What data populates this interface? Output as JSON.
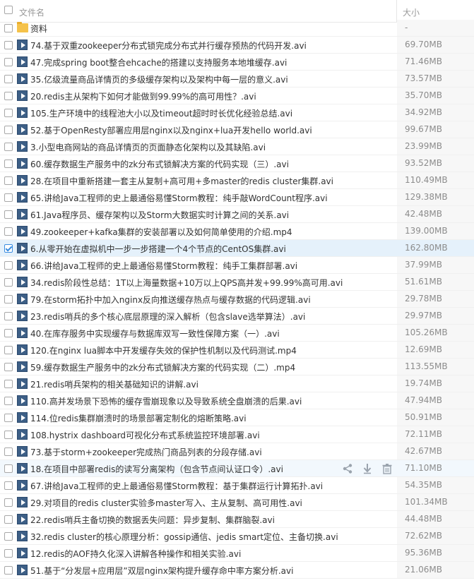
{
  "header": {
    "name_label": "文件名",
    "size_label": "大小"
  },
  "files": [
    {
      "name": "资料",
      "size": "-",
      "type": "folder",
      "checked": false
    },
    {
      "name": "74.基于双重zookeeper分布式锁完成分布式并行缓存预热的代码开发.avi",
      "size": "69.70MB",
      "type": "video",
      "checked": false
    },
    {
      "name": "47.完成spring boot整合ehcache的搭建以支持服务本地堆缓存.avi",
      "size": "71.46MB",
      "type": "video",
      "checked": false
    },
    {
      "name": "35.亿级流量商品详情页的多级缓存架构以及架构中每一层的意义.avi",
      "size": "73.57MB",
      "type": "video",
      "checked": false
    },
    {
      "name": "20.redis主从架构下如何才能做到99.99%的高可用性？.avi",
      "size": "35.70MB",
      "type": "video",
      "checked": false
    },
    {
      "name": "105.生产环境中的线程池大小以及timeout超时时长优化经验总结.avi",
      "size": "34.92MB",
      "type": "video",
      "checked": false
    },
    {
      "name": "52.基于OpenResty部署应用层nginx以及nginx+lua开发hello world.avi",
      "size": "99.67MB",
      "type": "video",
      "checked": false
    },
    {
      "name": "3.小型电商网站的商品详情页的页面静态化架构以及其缺陷.avi",
      "size": "23.99MB",
      "type": "video",
      "checked": false
    },
    {
      "name": "60.缓存数据生产服务中的zk分布式锁解决方案的代码实现（三）.avi",
      "size": "93.52MB",
      "type": "video",
      "checked": false
    },
    {
      "name": "28.在项目中重新搭建一套主从复制+高可用+多master的redis cluster集群.avi",
      "size": "110.49MB",
      "type": "video",
      "checked": false
    },
    {
      "name": "65.讲给Java工程师的史上最通俗易懂Storm教程：纯手敲WordCount程序.avi",
      "size": "129.38MB",
      "type": "video",
      "checked": false
    },
    {
      "name": "61.Java程序员、缓存架构以及Storm大数据实时计算之间的关系.avi",
      "size": "42.48MB",
      "type": "video",
      "checked": false
    },
    {
      "name": "49.zookeeper+kafka集群的安装部署以及如何简单使用的介绍.mp4",
      "size": "139.00MB",
      "type": "video",
      "checked": false
    },
    {
      "name": "6.从零开始在虚拟机中一步一步搭建一个4个节点的CentOS集群.avi",
      "size": "162.80MB",
      "type": "video",
      "checked": true
    },
    {
      "name": "66.讲给Java工程师的史上最通俗易懂Storm教程：纯手工集群部署.avi",
      "size": "37.99MB",
      "type": "video",
      "checked": false
    },
    {
      "name": "34.redis阶段性总结：1T以上海量数据+10万以上QPS高并发+99.99%高可用.avi",
      "size": "51.61MB",
      "type": "video",
      "checked": false
    },
    {
      "name": "79.在storm拓扑中加入nginx反向推送缓存热点与缓存数据的代码逻辑.avi",
      "size": "29.78MB",
      "type": "video",
      "checked": false
    },
    {
      "name": "23.redis哨兵的多个核心底层原理的深入解析（包含slave选举算法）.avi",
      "size": "29.97MB",
      "type": "video",
      "checked": false
    },
    {
      "name": "40.在库存服务中实现缓存与数据库双写一致性保障方案（一）.avi",
      "size": "105.26MB",
      "type": "video",
      "checked": false
    },
    {
      "name": "120.在nginx lua脚本中开发缓存失效的保护性机制以及代码测试.mp4",
      "size": "12.69MB",
      "type": "video",
      "checked": false
    },
    {
      "name": "59.缓存数据生产服务中的zk分布式锁解决方案的代码实现（二）.mp4",
      "size": "113.55MB",
      "type": "video",
      "checked": false
    },
    {
      "name": "21.redis哨兵架构的相关基础知识的讲解.avi",
      "size": "19.74MB",
      "type": "video",
      "checked": false
    },
    {
      "name": "110.高并发场景下恐怖的缓存雪崩现象以及导致系统全盘崩溃的后果.avi",
      "size": "47.94MB",
      "type": "video",
      "checked": false
    },
    {
      "name": "114.位redis集群崩溃时的场景部署定制化的熔断策略.avi",
      "size": "50.91MB",
      "type": "video",
      "checked": false
    },
    {
      "name": "108.hystrix dashboard可视化分布式系统监控环境部署.avi",
      "size": "72.11MB",
      "type": "video",
      "checked": false
    },
    {
      "name": "73.基于storm+zookeeper完成热门商品列表的分段存储.avi",
      "size": "42.67MB",
      "type": "video",
      "checked": false
    },
    {
      "name": "18.在项目中部署redis的读写分离架构（包含节点间认证口令）.avi",
      "size": "71.10MB",
      "type": "video",
      "checked": false,
      "hover": true
    },
    {
      "name": "67.讲给Java工程师的史上最通俗易懂Storm教程：基于集群运行计算拓扑.avi",
      "size": "54.35MB",
      "type": "video",
      "checked": false
    },
    {
      "name": "29.对项目的redis cluster实验多master写入、主从复制、高可用性.avi",
      "size": "101.34MB",
      "type": "video",
      "checked": false
    },
    {
      "name": "22.redis哨兵主备切换的数据丢失问题：异步复制、集群脑裂.avi",
      "size": "44.48MB",
      "type": "video",
      "checked": false
    },
    {
      "name": "32.redis cluster的核心原理分析：gossip通信、jedis smart定位、主备切换.avi",
      "size": "72.62MB",
      "type": "video",
      "checked": false
    },
    {
      "name": "12.redis的AOF持久化深入讲解各种操作和相关实验.avi",
      "size": "95.36MB",
      "type": "video",
      "checked": false
    },
    {
      "name": "51.基于“分发层+应用层”双层nginx架构提升缓存命中率方案分析.avi",
      "size": "21.06MB",
      "type": "video",
      "checked": false
    }
  ],
  "hover_actions": [
    "share-icon",
    "download-icon",
    "delete-icon"
  ]
}
